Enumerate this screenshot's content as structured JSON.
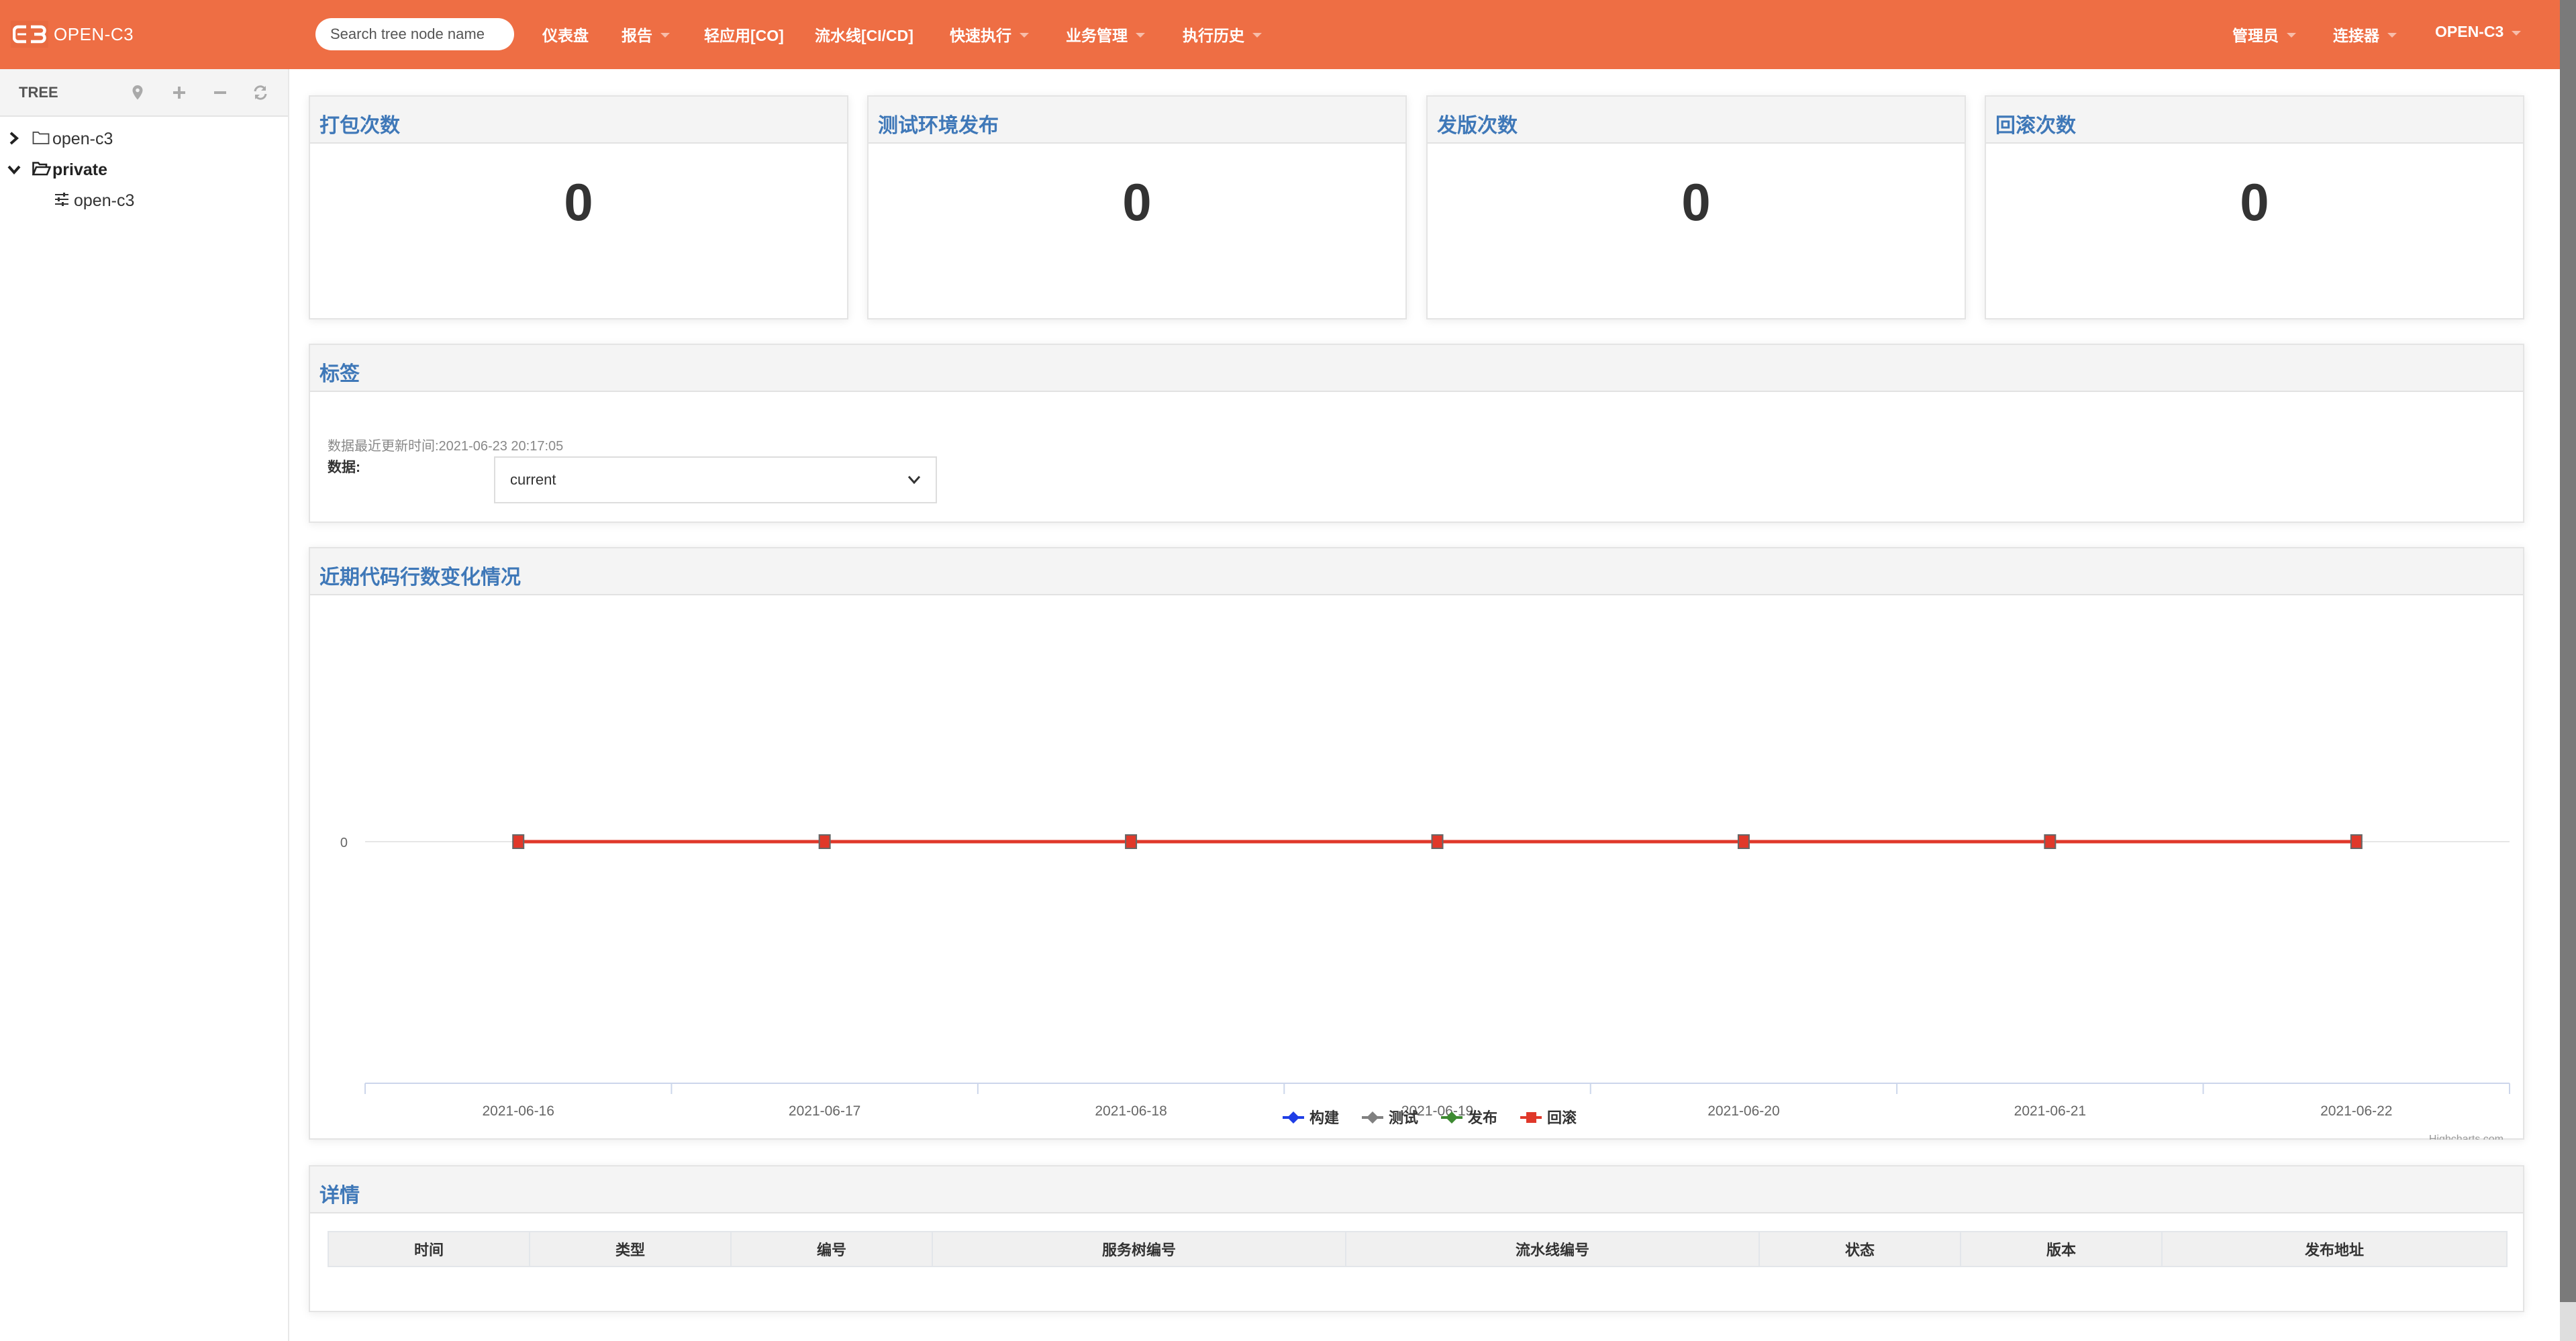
{
  "header": {
    "brand": "OPEN-C3",
    "search_placeholder": "Search tree node name",
    "nav": [
      {
        "label": "仪表盘",
        "dropdown": false
      },
      {
        "label": "报告",
        "dropdown": true
      },
      {
        "label": "轻应用[CO]",
        "dropdown": false
      },
      {
        "label": "流水线[CI/CD]",
        "dropdown": false
      },
      {
        "label": "快速执行",
        "dropdown": true
      },
      {
        "label": "业务管理",
        "dropdown": true
      },
      {
        "label": "执行历史",
        "dropdown": true
      }
    ],
    "nav_right": [
      {
        "label": "管理员",
        "dropdown": true
      },
      {
        "label": "连接器",
        "dropdown": true
      },
      {
        "label": "OPEN-C3",
        "dropdown": true
      }
    ],
    "bg_color": "#ee6e44"
  },
  "sidebar": {
    "title": "TREE",
    "tools": [
      "locate-icon",
      "plus-icon",
      "minus-icon",
      "refresh-icon"
    ],
    "nodes": [
      {
        "label": "open-c3",
        "level": 0,
        "expanded": false,
        "icon": "folder-icon",
        "bold": false
      },
      {
        "label": "private",
        "level": 0,
        "expanded": true,
        "icon": "folder-open-icon",
        "bold": true
      },
      {
        "label": "open-c3",
        "level": 1,
        "icon": "sliders-icon",
        "bold": false
      }
    ]
  },
  "stats": [
    {
      "title": "打包次数",
      "value": "0"
    },
    {
      "title": "测试环境发布",
      "value": "0"
    },
    {
      "title": "发版次数",
      "value": "0"
    },
    {
      "title": "回滚次数",
      "value": "0"
    }
  ],
  "tags": {
    "title": "标签",
    "updated_text": "数据最近更新时间:2021-06-23 20:17:05",
    "data_label": "数据:",
    "selected": "current"
  },
  "chart_panel": {
    "title": "近期代码行数变化情况",
    "credit": "Highcharts.com"
  },
  "chart_data": {
    "type": "line",
    "title": "",
    "xlabel": "",
    "ylabel": "",
    "categories": [
      "2021-06-16",
      "2021-06-17",
      "2021-06-18",
      "2021-06-19",
      "2021-06-20",
      "2021-06-21",
      "2021-06-22"
    ],
    "y_ticks": [
      "0"
    ],
    "series": [
      {
        "name": "构建",
        "color": "#1f3ee6",
        "marker": "diamond",
        "values": [
          0,
          0,
          0,
          0,
          0,
          0,
          0
        ]
      },
      {
        "name": "测试",
        "color": "#808080",
        "marker": "diamond",
        "values": [
          0,
          0,
          0,
          0,
          0,
          0,
          0
        ]
      },
      {
        "name": "发布",
        "color": "#3e8a32",
        "marker": "diamond",
        "values": [
          0,
          0,
          0,
          0,
          0,
          0,
          0
        ]
      },
      {
        "name": "回滚",
        "color": "#e0382a",
        "marker": "square",
        "values": [
          0,
          0,
          0,
          0,
          0,
          0,
          0
        ]
      }
    ],
    "grid": true,
    "legend": "bottom-center"
  },
  "details": {
    "title": "详情",
    "columns": [
      "时间",
      "类型",
      "编号",
      "服务树编号",
      "流水线编号",
      "状态",
      "版本",
      "发布地址"
    ],
    "rows": []
  }
}
